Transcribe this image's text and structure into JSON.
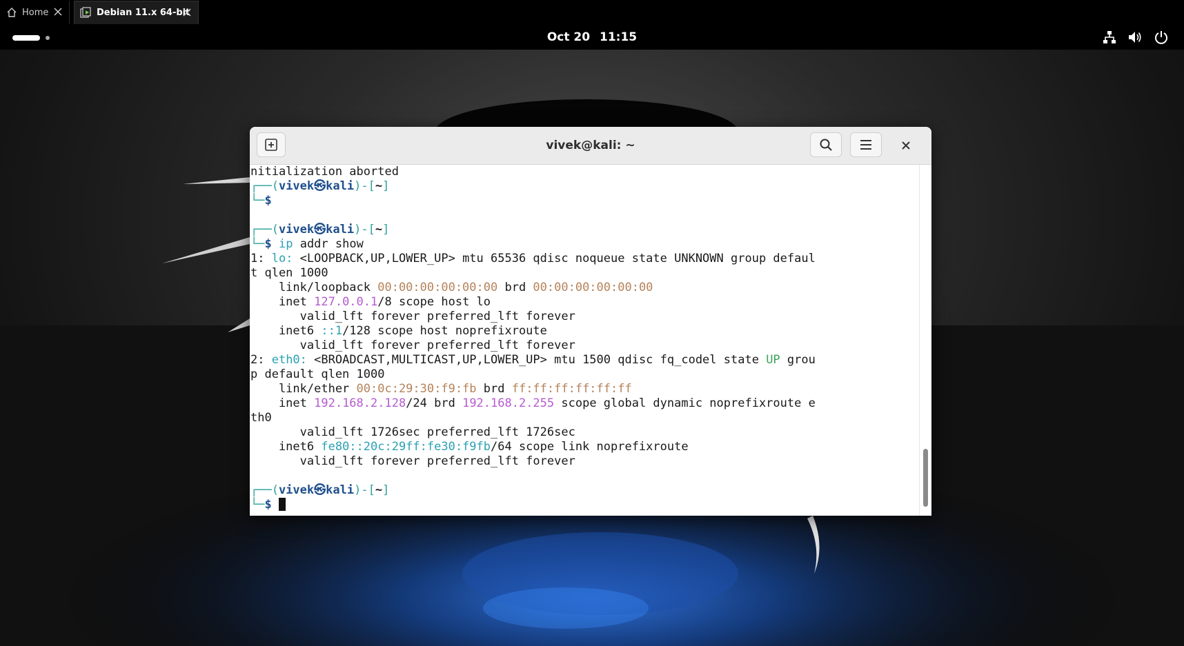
{
  "vm_tabs": {
    "home_label": "Home",
    "debian_label": "Debian 11.x 64-bit"
  },
  "topbar": {
    "date": "Oct 20",
    "time": "11:15"
  },
  "icons": {
    "home": "home-icon",
    "vm": "vm-console-icon",
    "network": "network-icon",
    "volume": "volume-icon",
    "power": "power-icon",
    "new_tab": "new-tab-icon",
    "search": "search-icon",
    "menu": "hamburger-menu-icon",
    "close": "close-icon"
  },
  "terminal": {
    "title": "vivek@kali: ~",
    "prompt": {
      "user": "vivek",
      "at": "㉿",
      "host": "kali",
      "dir": "~",
      "symbol": "$"
    },
    "lines": {
      "l1": "nitialization aborted",
      "cmd": "ip",
      "cmd_args": " addr show",
      "lo_idx": "1: ",
      "lo_name": "lo:",
      "lo_rest": " <LOOPBACK,UP,LOWER_UP> mtu 65536 qdisc noqueue state UNKNOWN group defaul",
      "lo_wrap": "t qlen 1000",
      "lo_link_pre": "    link/loopback ",
      "lo_mac": "00:00:00:00:00:00",
      "lo_brd": " brd ",
      "lo_brd_mac": "00:00:00:00:00:00",
      "lo_inet_pre": "    inet ",
      "lo_ip": "127.0.0.1",
      "lo_inet_post": "/8 scope host lo",
      "valid_forever": "       valid_lft forever preferred_lft forever",
      "lo_inet6_pre": "    inet6 ",
      "lo_ip6": "::1",
      "lo_inet6_post": "/128 scope host noprefixroute",
      "eth_idx": "2: ",
      "eth_name": "eth0:",
      "eth_rest": " <BROADCAST,MULTICAST,UP,LOWER_UP> mtu 1500 qdisc fq_codel state ",
      "eth_state": "UP",
      "eth_grou": " grou",
      "eth_wrap": "p default qlen 1000",
      "eth_link_pre": "    link/ether ",
      "eth_mac": "00:0c:29:30:f9:fb",
      "eth_brd": " brd ",
      "eth_brd_mac": "ff:ff:ff:ff:ff:ff",
      "eth_inet_pre": "    inet ",
      "eth_ip": "192.168.2.128",
      "eth_mid": "/24 brd ",
      "eth_bcast": "192.168.2.255",
      "eth_inet_post": " scope global dynamic noprefixroute e",
      "eth_wrap2": "th0",
      "eth_valid": "       valid_lft 1726sec preferred_lft 1726sec",
      "eth_inet6_pre": "    inet6 ",
      "eth_ip6": "fe80::20c:29ff:fe30:f9fb",
      "eth_inet6_post": "/64 scope link noprefixroute"
    }
  }
}
